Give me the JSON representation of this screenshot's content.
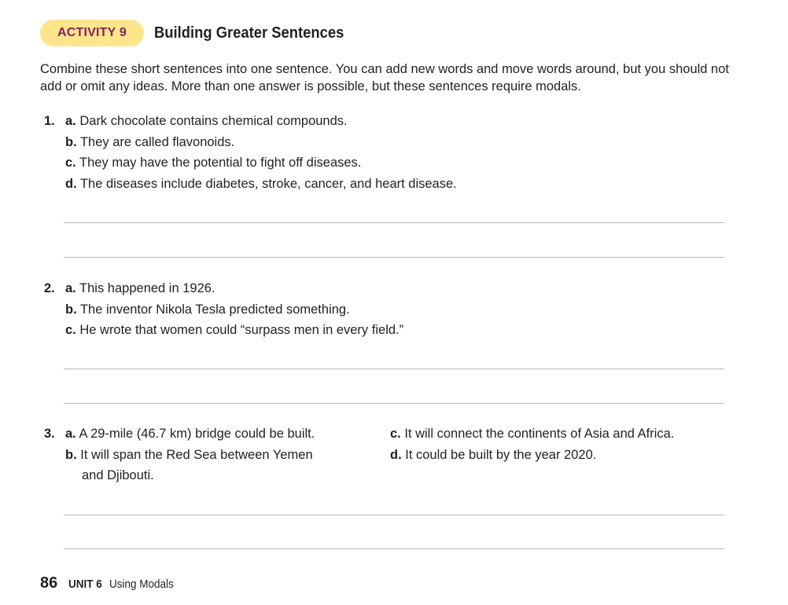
{
  "activity": {
    "badge": "ACTIVITY 9",
    "title": "Building Greater Sentences"
  },
  "instructions": "Combine these short sentences into one sentence. You can add new words and move words around, but you should not add or omit any ideas. More than one answer is possible, but these sentences require modals.",
  "items": [
    {
      "number": "1.",
      "parts": [
        {
          "letter": "a.",
          "text": " Dark chocolate contains chemical compounds."
        },
        {
          "letter": "b.",
          "text": " They are called flavonoids."
        },
        {
          "letter": "c.",
          "text": " They may have the potential to fight off diseases."
        },
        {
          "letter": "d.",
          "text": " The diseases include diabetes, stroke, cancer, and heart disease."
        }
      ]
    },
    {
      "number": "2.",
      "parts": [
        {
          "letter": "a.",
          "text": " This happened in 1926."
        },
        {
          "letter": "b.",
          "text": " The inventor Nikola Tesla predicted something."
        },
        {
          "letter": "c.",
          "text": " He wrote that women could “surpass men in every field.”"
        }
      ]
    },
    {
      "number": "3.",
      "parts": [
        {
          "letter": "a.",
          "text": " A 29-mile (46.7 km) bridge could be built."
        },
        {
          "letter": "b.",
          "text": " It will span the Red Sea between Yemen",
          "continuation": "and Djibouti."
        },
        {
          "letter": "c.",
          "text": " It will connect the continents of Asia and Africa."
        },
        {
          "letter": "d.",
          "text": " It could be built by the year 2020."
        }
      ]
    }
  ],
  "footer": {
    "page_number": "86",
    "unit": "UNIT 6",
    "unit_title": "Using Modals"
  },
  "colors": {
    "badge_background": "#fde58c",
    "badge_text": "#8a1e5b",
    "answer_line": "#b7b7b7"
  }
}
